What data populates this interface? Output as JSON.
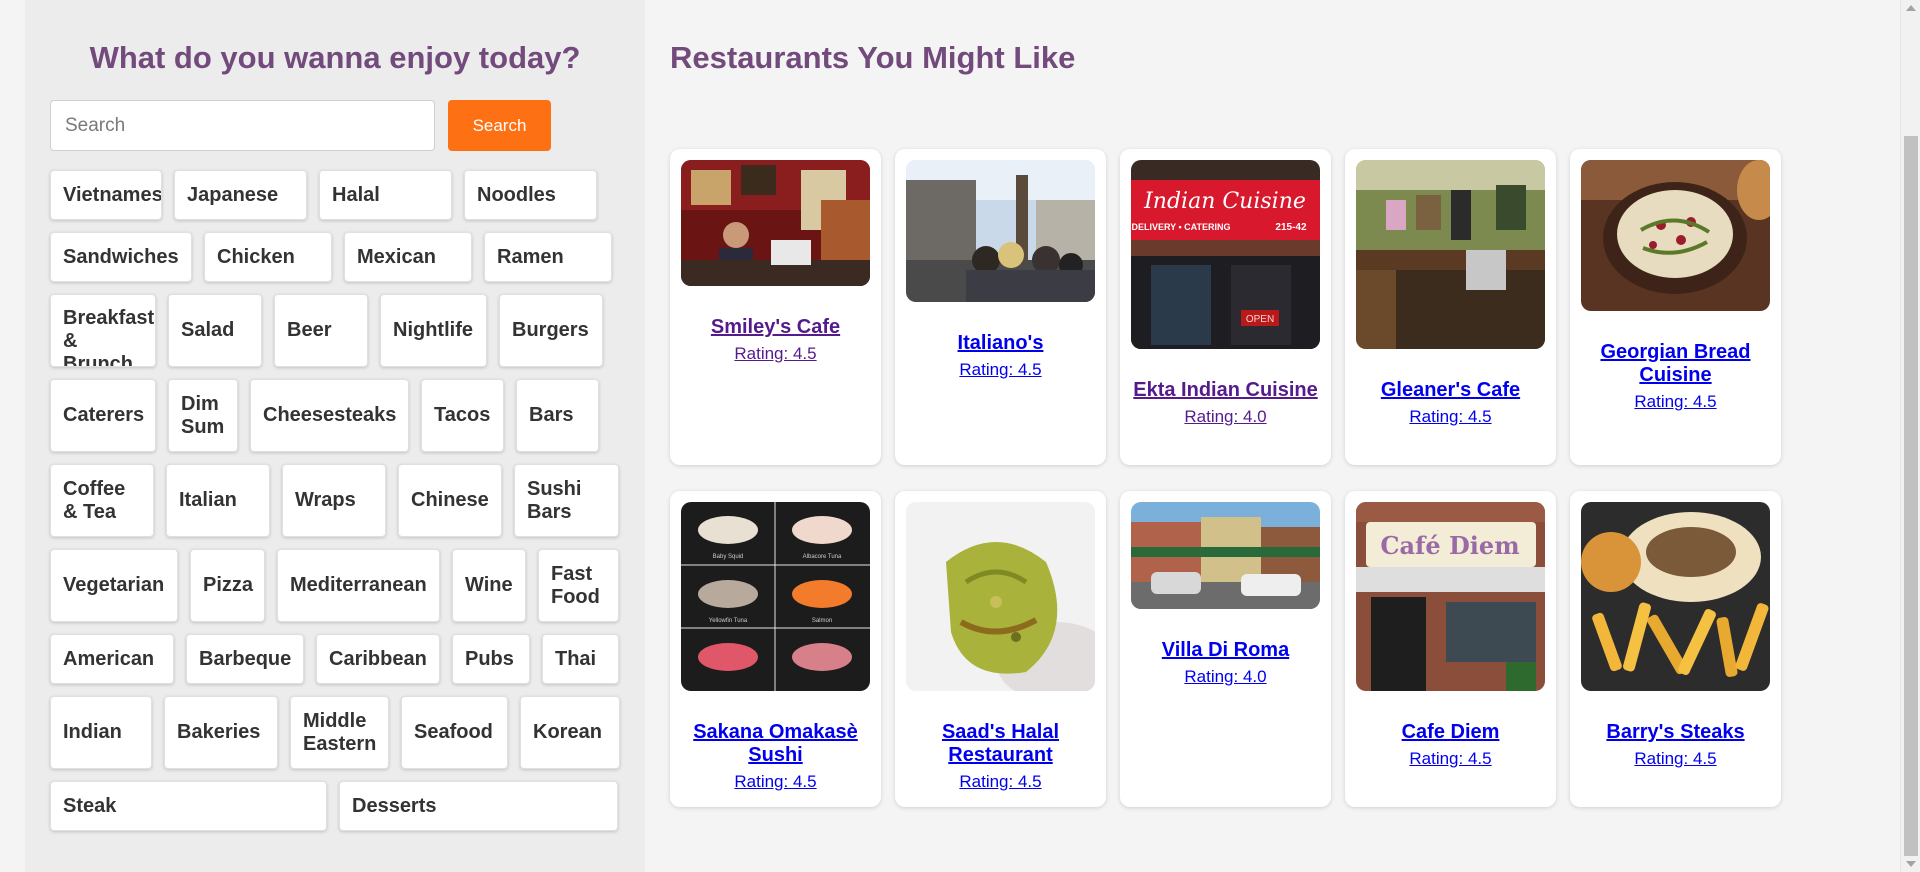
{
  "left": {
    "title": "What do you wanna enjoy today?",
    "search_placeholder": "Search",
    "search_button": "Search"
  },
  "categories": [
    [
      "Vietnamese",
      "Japanese",
      "Halal",
      "Noodles"
    ],
    [
      "Sandwiches",
      "Chicken",
      "Mexican",
      "Ramen"
    ],
    [
      "Breakfast & Brunch",
      "Salad",
      "Beer",
      "Nightlife",
      "Burgers"
    ],
    [
      "Caterers",
      "Dim Sum",
      "Cheesesteaks",
      "Tacos",
      "Bars"
    ],
    [
      "Coffee & Tea",
      "Italian",
      "Wraps",
      "Chinese",
      "Sushi Bars"
    ],
    [
      "Vegetarian",
      "Pizza",
      "Mediterranean",
      "Wine",
      "Fast Food"
    ],
    [
      "American",
      "Barbeque",
      "Caribbean",
      "Pubs",
      "Thai"
    ],
    [
      "Indian",
      "Bakeries",
      "Middle Eastern",
      "Seafood",
      "Korean"
    ],
    [
      "Steak",
      "Desserts"
    ]
  ],
  "right": {
    "title": "Restaurants You Might Like"
  },
  "restaurants": [
    {
      "name": "Smiley's Cafe",
      "rating": "Rating: 4.5",
      "photo": "restaurant-interior-chef",
      "visited": true
    },
    {
      "name": "Italiano's",
      "rating": "Rating: 4.5",
      "photo": "street-crowd",
      "visited": false
    },
    {
      "name": "Ekta Indian Cuisine",
      "rating": "Rating: 4.0",
      "photo": "indian-storefront",
      "visited": true
    },
    {
      "name": "Gleaner's Cafe",
      "rating": "Rating: 4.5",
      "photo": "cafe-counter",
      "visited": false
    },
    {
      "name": "Georgian Bread Cuisine",
      "rating": "Rating: 4.5",
      "photo": "salad-bowl",
      "visited": false
    },
    {
      "name": "Sakana Omakasè Sushi",
      "rating": "Rating: 4.5",
      "photo": "sushi-platter",
      "visited": false
    },
    {
      "name": "Saad's Halal Restaurant",
      "rating": "Rating: 4.5",
      "photo": "falafel-closeup",
      "visited": false
    },
    {
      "name": "Villa Di Roma",
      "rating": "Rating: 4.0",
      "photo": "street-view",
      "visited": false
    },
    {
      "name": "Cafe Diem",
      "rating": "Rating: 4.5",
      "photo": "cafe-storefront",
      "visited": false
    },
    {
      "name": "Barry's Steaks",
      "rating": "Rating: 4.5",
      "photo": "cheesesteak-fries",
      "visited": false
    }
  ],
  "storefront_signs": {
    "ekta": "Indian Cuisine",
    "ekta_sub": "DELIVERY • CATERING",
    "ekta_phone": "215-42",
    "ekta_open": "OPEN",
    "diem": "Café Diem"
  },
  "sushi_labels": [
    "Baby Squid",
    "Albacore Tuna",
    "Yellowfin Tuna",
    "Salmon"
  ],
  "colors": {
    "title": "#734a7c",
    "search_button": "#fd7014",
    "link": "#0000ee",
    "visited_link": "#551a8b"
  }
}
